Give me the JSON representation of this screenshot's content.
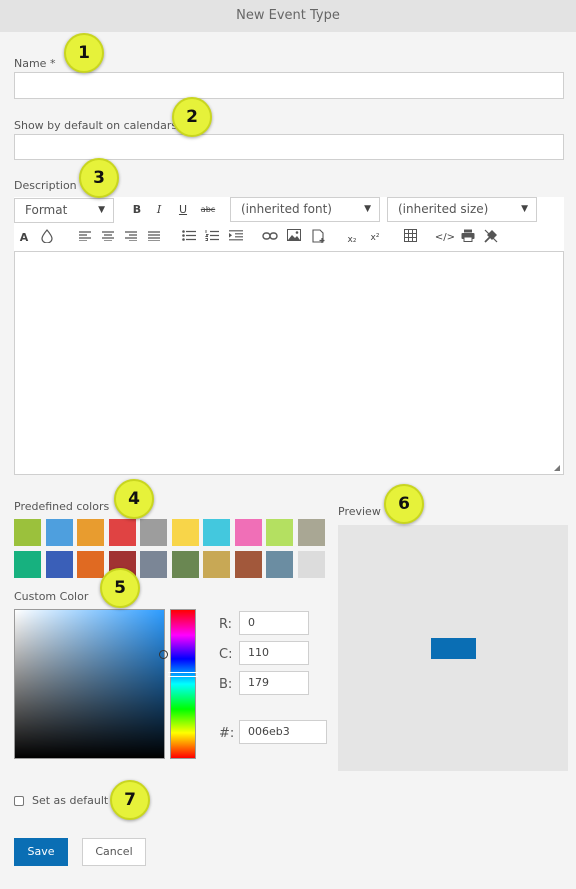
{
  "dialog": {
    "title": "New Event Type"
  },
  "form": {
    "name_label": "Name *",
    "name_value": "",
    "show_default_label": "Show by default on calendars",
    "show_default_value": "",
    "description_label": "Description"
  },
  "toolbar": {
    "format_label": "Format",
    "font_label": "(inherited font)",
    "size_label": "(inherited size)",
    "bold": "B",
    "italic": "I",
    "underline": "U",
    "strike": "abc",
    "font_color": "A",
    "subscript": "x₂",
    "superscript": "x²",
    "source": "</>"
  },
  "colors": {
    "predefined_label": "Predefined colors",
    "row1": [
      "#9bc13c",
      "#4e9fde",
      "#e89c2f",
      "#e04343",
      "#9d9d9d",
      "#f8d549",
      "#43c8de",
      "#f06fb7",
      "#b4e061",
      "#a9a794"
    ],
    "row2": [
      "#17b17f",
      "#3a5fb8",
      "#e06a22",
      "#a13232",
      "#7b8696",
      "#6a8752",
      "#c8a855",
      "#a2583b",
      "#6b8da2",
      "#dcdcdc"
    ],
    "custom_label": "Custom Color",
    "r_label": "R:",
    "r_value": "0",
    "g_label": "C:",
    "g_value": "110",
    "b_label": "B:",
    "b_value": "179",
    "hex_label": "#:",
    "hex_value": "006eb3",
    "selected": "#006eb3"
  },
  "preview": {
    "label": "Preview",
    "swatch_color": "#0a6eb4"
  },
  "set_default": {
    "label": "Set as default",
    "checked": false
  },
  "actions": {
    "save": "Save",
    "cancel": "Cancel"
  },
  "callouts": [
    "1",
    "2",
    "3",
    "4",
    "5",
    "6",
    "7"
  ]
}
